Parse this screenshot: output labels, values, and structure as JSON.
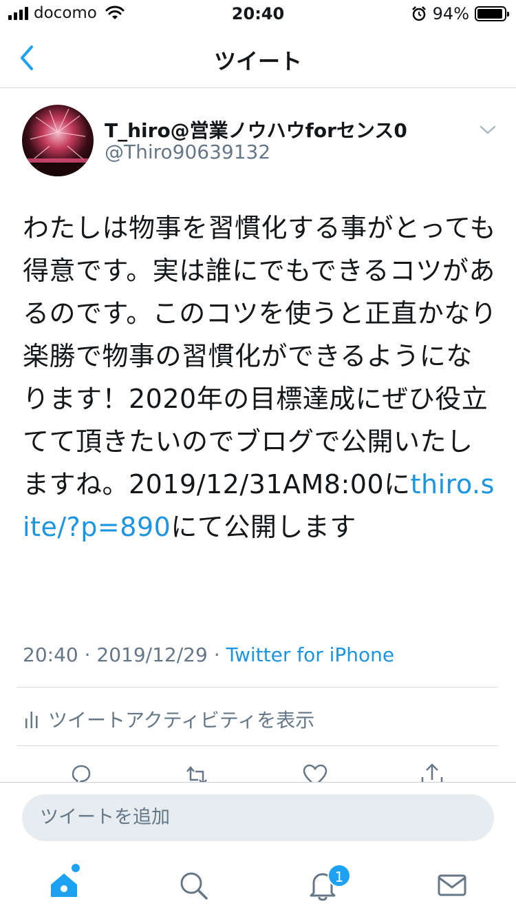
{
  "status_bar": {
    "carrier": "docomo",
    "time": "20:40",
    "battery_percent": "94%",
    "battery_level": 0.94
  },
  "nav": {
    "title": "ツイート"
  },
  "tweet": {
    "author_name": "T_hiro@営業ノウハウforセンス0",
    "author_handle": "@Thiro90639132",
    "text_before_link": "わたしは物事を習慣化する事がとっても得意です。実は誰にでもできるコツがあるのです。このコツを使うと正直かなり楽勝で物事の習慣化ができるようになります！2020年の目標達成にぜひ役立てて頂きたいのでブログで公開いたしますね。2019/12/31AM8:00に",
    "link_text": "thiro.site/?p=890",
    "text_after_link": "にて公開します",
    "time": "20:40",
    "date": "2019/12/29",
    "separator": " · ",
    "source": "Twitter for iPhone",
    "activity_label": "ツイートアクティビティを表示"
  },
  "compose": {
    "placeholder": "ツイートを追加"
  },
  "tab_bar": {
    "notification_badge": "1"
  },
  "colors": {
    "accent": "#1da1f2",
    "link": "#1b95e0",
    "secondary_text": "#657786",
    "divider": "#d6dde3"
  }
}
